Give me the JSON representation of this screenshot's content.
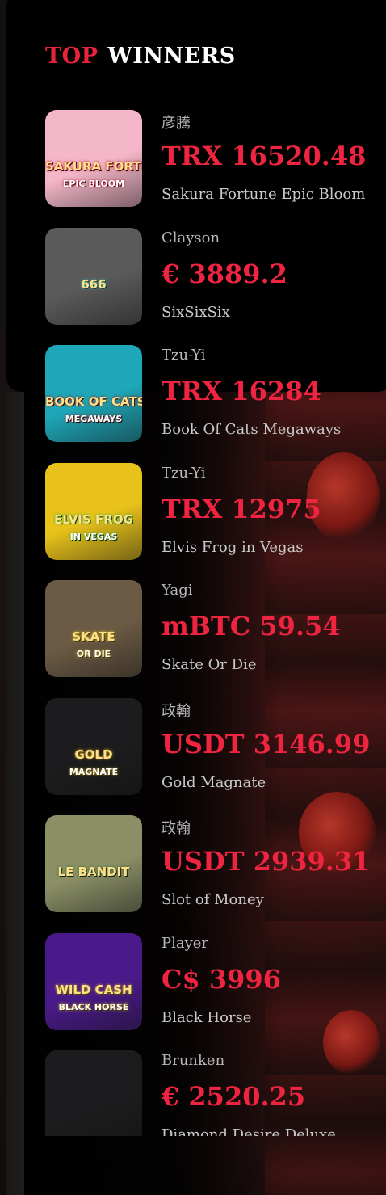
{
  "widget": {
    "title_part1": "TOP",
    "title_part2": "WINNERS"
  },
  "winners": [
    {
      "player": "彦騰",
      "amount": "TRX 16520.48",
      "game": "Sakura Fortune Epic Bloom",
      "thumb_text": "SAKURA FORTUNE",
      "thumb_subtext": "EPIC BLOOM",
      "thumb_bg": "#f4b7c9",
      "thumb_accent": "#c8102e"
    },
    {
      "player": "Clayson",
      "amount": "€ 3889.2",
      "game": "SixSixSix",
      "thumb_text": "666",
      "thumb_subtext": "",
      "thumb_bg": "#5a5a5a",
      "thumb_accent": "#3bc7c0"
    },
    {
      "player": "Tzu-Yi",
      "amount": "TRX 16284",
      "game": "Book Of Cats Megaways",
      "thumb_text": "BOOK OF CATS",
      "thumb_subtext": "MEGAWAYS",
      "thumb_bg": "#1ea7b8",
      "thumb_accent": "#8b1a12"
    },
    {
      "player": "Tzu-Yi",
      "amount": "TRX 12975",
      "game": "Elvis Frog in Vegas",
      "thumb_text": "ELVIS FROG",
      "thumb_subtext": "IN VEGAS",
      "thumb_bg": "#e8c21a",
      "thumb_accent": "#3ab335"
    },
    {
      "player": "Yagi",
      "amount": "mBTC 59.54",
      "game": "Skate Or Die",
      "thumb_text": "SKATE",
      "thumb_subtext": "OR DIE",
      "thumb_bg": "#6b5a44",
      "thumb_accent": "#e8c21a"
    },
    {
      "player": "政翰",
      "amount": "USDT 3146.99",
      "game": "Gold Magnate",
      "thumb_text": "GOLD",
      "thumb_subtext": "MAGNATE",
      "thumb_bg": "#1c1c1e",
      "thumb_accent": "#e8b21a"
    },
    {
      "player": "政翰",
      "amount": "USDT 2939.31",
      "game": "Slot of Money",
      "thumb_text": "LE BANDIT",
      "thumb_subtext": "",
      "thumb_bg": "#8a8f66",
      "thumb_accent": "#3a6a2a"
    },
    {
      "player": "Player",
      "amount": "C$ 3996",
      "game": "Black Horse",
      "thumb_text": "WILD CASH",
      "thumb_subtext": "BLACK HORSE",
      "thumb_bg": "#4a1a8a",
      "thumb_accent": "#e8c21a"
    },
    {
      "player": "Brunken",
      "amount": "€ 2520.25",
      "game": "Diamond Desire Deluxe",
      "thumb_text": "",
      "thumb_subtext": "",
      "thumb_bg": "#1c1c1e",
      "thumb_accent": "#1c1c1e"
    }
  ]
}
